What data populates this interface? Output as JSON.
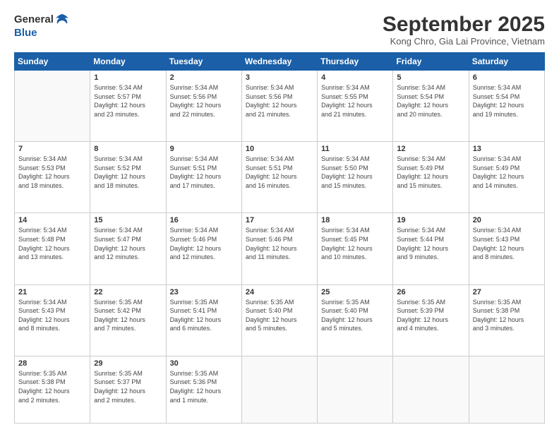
{
  "logo": {
    "line1": "General",
    "line2": "Blue"
  },
  "title": "September 2025",
  "location": "Kong Chro, Gia Lai Province, Vietnam",
  "days_header": [
    "Sunday",
    "Monday",
    "Tuesday",
    "Wednesday",
    "Thursday",
    "Friday",
    "Saturday"
  ],
  "weeks": [
    [
      {
        "day": "",
        "info": ""
      },
      {
        "day": "1",
        "info": "Sunrise: 5:34 AM\nSunset: 5:57 PM\nDaylight: 12 hours\nand 23 minutes."
      },
      {
        "day": "2",
        "info": "Sunrise: 5:34 AM\nSunset: 5:56 PM\nDaylight: 12 hours\nand 22 minutes."
      },
      {
        "day": "3",
        "info": "Sunrise: 5:34 AM\nSunset: 5:56 PM\nDaylight: 12 hours\nand 21 minutes."
      },
      {
        "day": "4",
        "info": "Sunrise: 5:34 AM\nSunset: 5:55 PM\nDaylight: 12 hours\nand 21 minutes."
      },
      {
        "day": "5",
        "info": "Sunrise: 5:34 AM\nSunset: 5:54 PM\nDaylight: 12 hours\nand 20 minutes."
      },
      {
        "day": "6",
        "info": "Sunrise: 5:34 AM\nSunset: 5:54 PM\nDaylight: 12 hours\nand 19 minutes."
      }
    ],
    [
      {
        "day": "7",
        "info": "Sunrise: 5:34 AM\nSunset: 5:53 PM\nDaylight: 12 hours\nand 18 minutes."
      },
      {
        "day": "8",
        "info": "Sunrise: 5:34 AM\nSunset: 5:52 PM\nDaylight: 12 hours\nand 18 minutes."
      },
      {
        "day": "9",
        "info": "Sunrise: 5:34 AM\nSunset: 5:51 PM\nDaylight: 12 hours\nand 17 minutes."
      },
      {
        "day": "10",
        "info": "Sunrise: 5:34 AM\nSunset: 5:51 PM\nDaylight: 12 hours\nand 16 minutes."
      },
      {
        "day": "11",
        "info": "Sunrise: 5:34 AM\nSunset: 5:50 PM\nDaylight: 12 hours\nand 15 minutes."
      },
      {
        "day": "12",
        "info": "Sunrise: 5:34 AM\nSunset: 5:49 PM\nDaylight: 12 hours\nand 15 minutes."
      },
      {
        "day": "13",
        "info": "Sunrise: 5:34 AM\nSunset: 5:49 PM\nDaylight: 12 hours\nand 14 minutes."
      }
    ],
    [
      {
        "day": "14",
        "info": "Sunrise: 5:34 AM\nSunset: 5:48 PM\nDaylight: 12 hours\nand 13 minutes."
      },
      {
        "day": "15",
        "info": "Sunrise: 5:34 AM\nSunset: 5:47 PM\nDaylight: 12 hours\nand 12 minutes."
      },
      {
        "day": "16",
        "info": "Sunrise: 5:34 AM\nSunset: 5:46 PM\nDaylight: 12 hours\nand 12 minutes."
      },
      {
        "day": "17",
        "info": "Sunrise: 5:34 AM\nSunset: 5:46 PM\nDaylight: 12 hours\nand 11 minutes."
      },
      {
        "day": "18",
        "info": "Sunrise: 5:34 AM\nSunset: 5:45 PM\nDaylight: 12 hours\nand 10 minutes."
      },
      {
        "day": "19",
        "info": "Sunrise: 5:34 AM\nSunset: 5:44 PM\nDaylight: 12 hours\nand 9 minutes."
      },
      {
        "day": "20",
        "info": "Sunrise: 5:34 AM\nSunset: 5:43 PM\nDaylight: 12 hours\nand 8 minutes."
      }
    ],
    [
      {
        "day": "21",
        "info": "Sunrise: 5:34 AM\nSunset: 5:43 PM\nDaylight: 12 hours\nand 8 minutes."
      },
      {
        "day": "22",
        "info": "Sunrise: 5:35 AM\nSunset: 5:42 PM\nDaylight: 12 hours\nand 7 minutes."
      },
      {
        "day": "23",
        "info": "Sunrise: 5:35 AM\nSunset: 5:41 PM\nDaylight: 12 hours\nand 6 minutes."
      },
      {
        "day": "24",
        "info": "Sunrise: 5:35 AM\nSunset: 5:40 PM\nDaylight: 12 hours\nand 5 minutes."
      },
      {
        "day": "25",
        "info": "Sunrise: 5:35 AM\nSunset: 5:40 PM\nDaylight: 12 hours\nand 5 minutes."
      },
      {
        "day": "26",
        "info": "Sunrise: 5:35 AM\nSunset: 5:39 PM\nDaylight: 12 hours\nand 4 minutes."
      },
      {
        "day": "27",
        "info": "Sunrise: 5:35 AM\nSunset: 5:38 PM\nDaylight: 12 hours\nand 3 minutes."
      }
    ],
    [
      {
        "day": "28",
        "info": "Sunrise: 5:35 AM\nSunset: 5:38 PM\nDaylight: 12 hours\nand 2 minutes."
      },
      {
        "day": "29",
        "info": "Sunrise: 5:35 AM\nSunset: 5:37 PM\nDaylight: 12 hours\nand 2 minutes."
      },
      {
        "day": "30",
        "info": "Sunrise: 5:35 AM\nSunset: 5:36 PM\nDaylight: 12 hours\nand 1 minute."
      },
      {
        "day": "",
        "info": ""
      },
      {
        "day": "",
        "info": ""
      },
      {
        "day": "",
        "info": ""
      },
      {
        "day": "",
        "info": ""
      }
    ]
  ]
}
